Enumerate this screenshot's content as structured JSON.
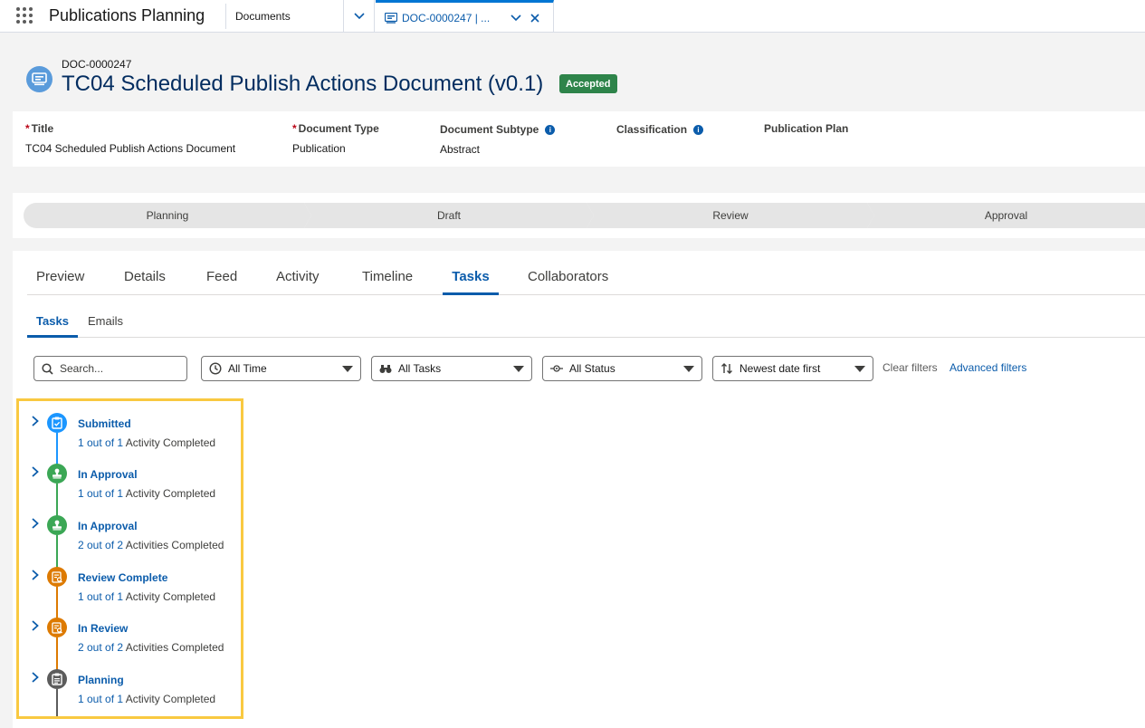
{
  "app": {
    "name": "Publications Planning"
  },
  "nav": {
    "documents_tab": "Documents",
    "active_tab": "DOC-0000247 | ..."
  },
  "record": {
    "id": "DOC-0000247",
    "title": "TC04 Scheduled Publish Actions Document (v0.1)",
    "status_badge": "Accepted",
    "icon": "document-icon"
  },
  "highlights": {
    "fields": [
      {
        "label": "Title",
        "required": true,
        "value": "TC04 Scheduled Publish Actions Document"
      },
      {
        "label": "Document Type",
        "required": true,
        "value": "Publication"
      },
      {
        "label": "Document Subtype",
        "info": true,
        "value": "Abstract"
      },
      {
        "label": "Classification",
        "info": true,
        "value": ""
      },
      {
        "label": "Publication Plan",
        "value": ""
      }
    ]
  },
  "path": {
    "stages": [
      "Planning",
      "Draft",
      "Review",
      "Approval"
    ]
  },
  "tabs": [
    "Preview",
    "Details",
    "Feed",
    "Activity",
    "Timeline",
    "Tasks",
    "Collaborators"
  ],
  "active_tab": "Tasks",
  "subtabs": [
    "Tasks",
    "Emails"
  ],
  "active_subtab": "Tasks",
  "filters": {
    "search_placeholder": "Search...",
    "time": "All Time",
    "tasks": "All Tasks",
    "status": "All Status",
    "sort": "Newest date first",
    "clear_label": "Clear filters",
    "advanced_label": "Advanced filters"
  },
  "timeline": {
    "items": [
      {
        "title": "Submitted",
        "count": "1 out of 1",
        "suffix": " Activity Completed",
        "color": "#1b96ff",
        "icon": "clipboard-check-icon"
      },
      {
        "title": "In Approval",
        "count": "1 out of 1",
        "suffix": " Activity Completed",
        "color": "#3ba755",
        "icon": "approval-stamp-icon"
      },
      {
        "title": "In Approval",
        "count": "2 out of 2",
        "suffix": " Activities Completed",
        "color": "#3ba755",
        "icon": "approval-stamp-icon"
      },
      {
        "title": "Review Complete",
        "count": "1 out of 1",
        "suffix": " Activity Completed",
        "color": "#dd7a01",
        "icon": "review-document-icon"
      },
      {
        "title": "In Review",
        "count": "2 out of 2",
        "suffix": " Activities Completed",
        "color": "#dd7a01",
        "icon": "review-document-icon"
      },
      {
        "title": "Planning",
        "count": "1 out of 1",
        "suffix": " Activity Completed",
        "color": "#5c5c5c",
        "icon": "checklist-icon"
      }
    ]
  }
}
